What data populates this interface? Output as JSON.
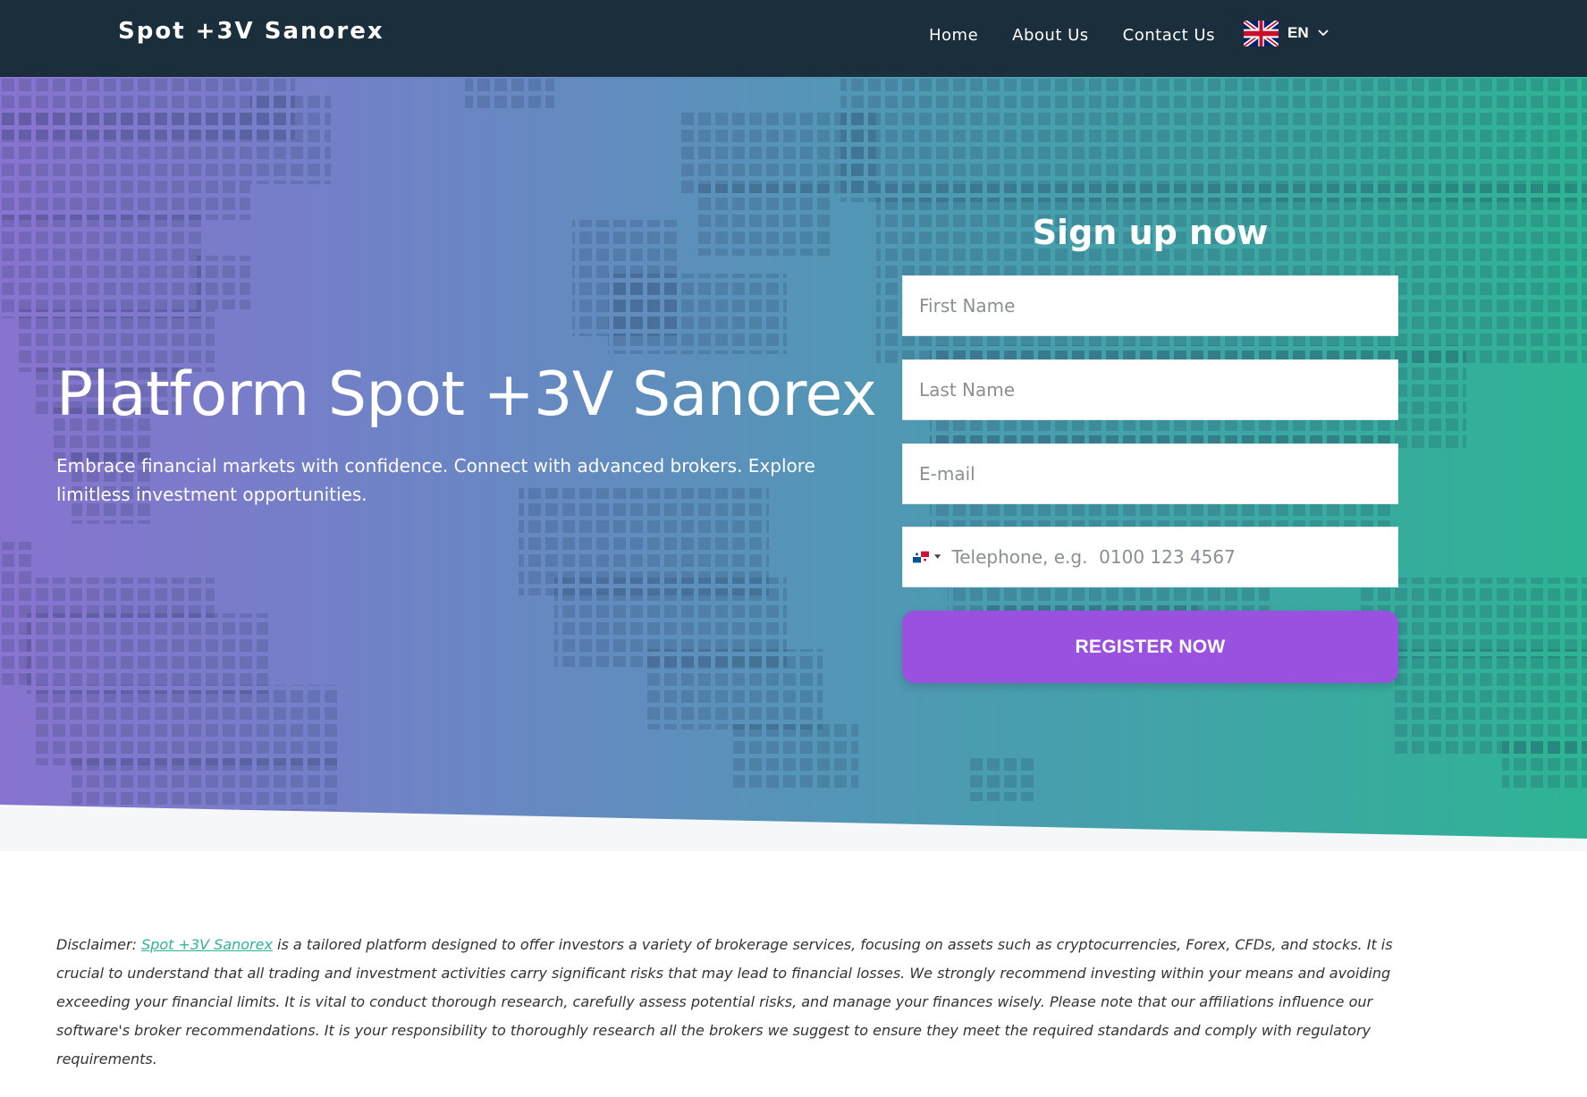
{
  "nav": {
    "brand": "Spot +3V Sanorex",
    "links": [
      "Home",
      "About Us",
      "Contact Us"
    ],
    "language": "EN"
  },
  "hero": {
    "title": "Platform Spot +3V Sanorex",
    "subtitle": "Embrace financial markets with confidence. Connect with advanced brokers. Explore limitless investment opportunities."
  },
  "signup": {
    "title": "Sign up now",
    "first_name_placeholder": "First Name",
    "last_name_placeholder": "Last Name",
    "email_placeholder": "E-mail",
    "phone_placeholder": "Telephone, e.g.  0100 123 4567",
    "button_label": "REGISTER NOW"
  },
  "disclaimer": {
    "prefix": "Disclaimer: ",
    "link_text": "Spot +3V Sanorex",
    "body": " is a tailored platform designed to offer investors a variety of brokerage services, focusing on assets such as cryptocurrencies, Forex, CFDs, and stocks. It is crucial to understand that all trading and investment activities carry significant risks that may lead to financial losses. We strongly recommend investing within your means and avoiding exceeding your financial limits. It is vital to conduct thorough research, carefully assess potential risks, and manage your finances wisely. Please note that our affiliations influence our software's broker recommendations. It is your responsibility to thoroughly research all the brokers we suggest to ensure they meet the required standards and comply with regulatory requirements."
  },
  "colors": {
    "nav_bg": "#1a2e3b",
    "gradient_start": "#8873cf",
    "gradient_end": "#2eb494",
    "button": "#9b51e0",
    "link": "#2eb494"
  },
  "icons": {
    "language_flag": "uk-flag-icon",
    "language_dropdown": "chevron-down-icon",
    "phone_country_flag": "panama-flag-icon",
    "phone_country_dropdown": "caret-down-icon",
    "background": "world-map-pattern"
  }
}
